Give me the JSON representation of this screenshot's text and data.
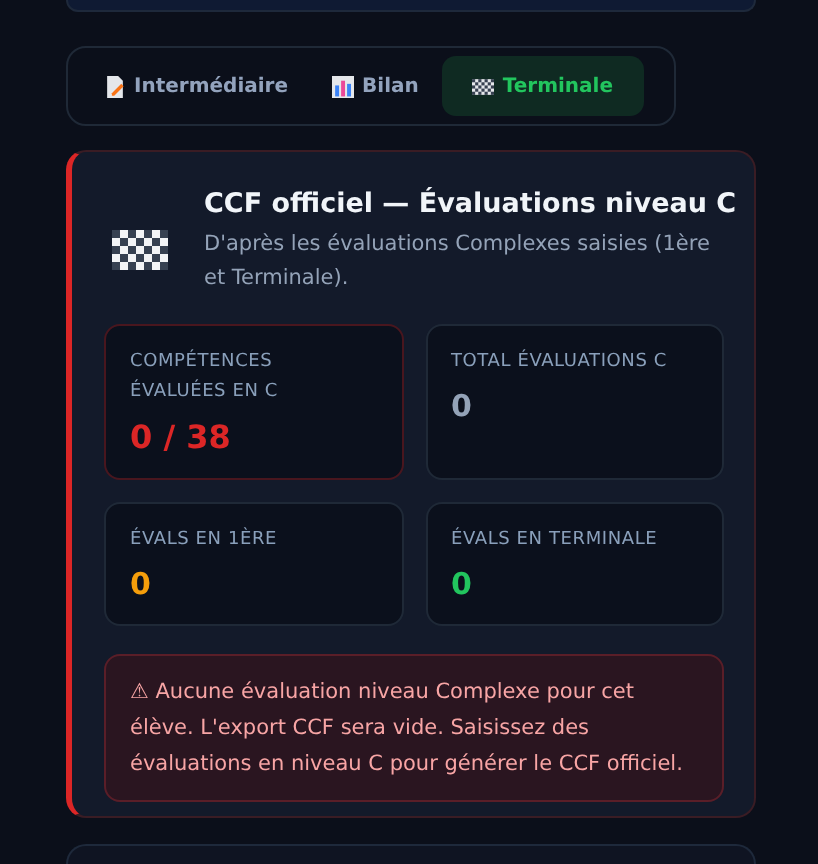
{
  "tabs": [
    {
      "label": "Intermédiaire",
      "kind": "document",
      "selected": false
    },
    {
      "label": "Bilan",
      "kind": "chart",
      "selected": false
    },
    {
      "label": "Terminale",
      "kind": "checker",
      "selected": true
    }
  ],
  "card": {
    "title": "CCF officiel — Évaluations niveau C",
    "subtitle": "D'après les évaluations Complexes saisies (1ère et Terminale).",
    "stats": [
      {
        "label": "COMPÉTENCES ÉVALUÉES EN C",
        "value": "0 / 38",
        "color": "#dc2626"
      },
      {
        "label": "TOTAL ÉVALUATIONS C",
        "value": "0",
        "color": "#94a3b8"
      },
      {
        "label": "ÉVALS EN 1ÈRE",
        "value": "0",
        "color": "#f59e0b"
      },
      {
        "label": "ÉVALS EN TERMINALE",
        "value": "0",
        "color": "#22c55e"
      }
    ],
    "warning": "⚠ Aucune évaluation niveau Complexe pour cet élève. L'export CCF sera vide. Saisissez des évaluations en niveau C pour générer le CCF officiel."
  }
}
